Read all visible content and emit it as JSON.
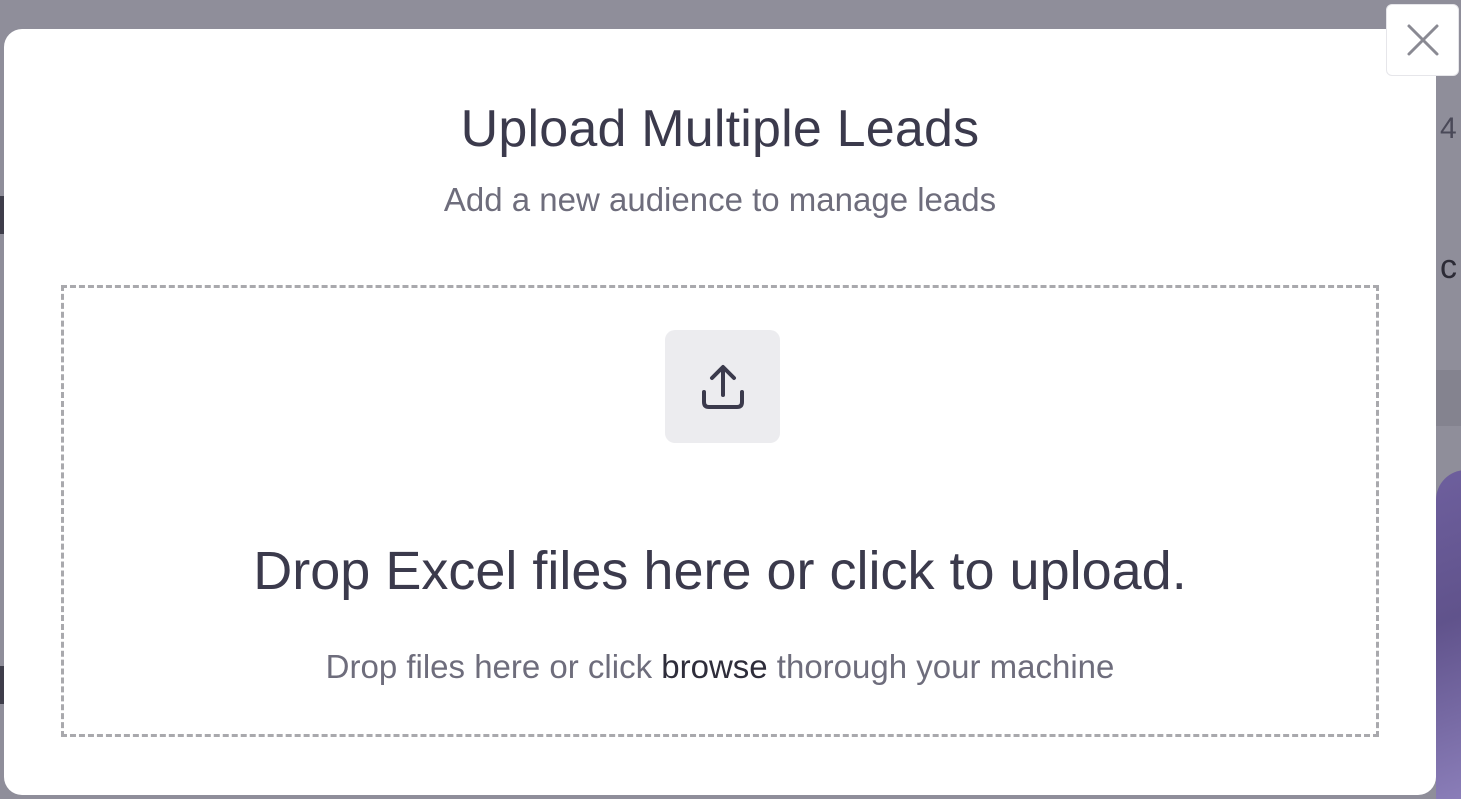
{
  "modal": {
    "title": "Upload Multiple Leads",
    "subtitle": "Add a new audience to manage leads",
    "close_icon": "close-icon"
  },
  "dropzone": {
    "icon": "upload-icon",
    "heading": "Drop Excel files here or click to upload.",
    "hint_before": "Drop files here or click ",
    "hint_link": "browse",
    "hint_after": " thorough your machine"
  },
  "background": {
    "partial_text_1": "4",
    "partial_text_2": "c"
  },
  "colors": {
    "overlay": "#8f8e9a",
    "text_primary": "#3b3a4c",
    "text_secondary": "#6e6d7c",
    "dashed_border": "#a9a9ad",
    "icon_box": "#ececef"
  }
}
